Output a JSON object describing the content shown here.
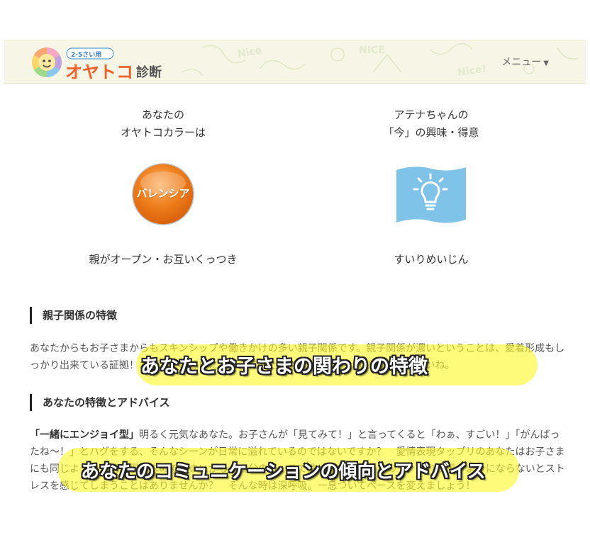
{
  "header": {
    "logo_age_tag": "2-5さい用",
    "logo_title": "オヤトコ",
    "logo_suffix": "診断",
    "menu_label": "メニュー"
  },
  "result_left": {
    "title_line1": "あなたの",
    "title_line2": "オヤトコカラーは",
    "badge_text": "バレンシア",
    "badge_color": "#ee7d1a",
    "caption": "親がオープン・お互いくっつき"
  },
  "result_right": {
    "title_line1": "アテナちゃんの",
    "title_line2": "「今」の興味・得意",
    "icon": "lightbulb-icon",
    "flag_color": "#7fc3e8",
    "caption": "すいりめいじん"
  },
  "section1": {
    "heading": "親子関係の特徴",
    "text": "あなたからもお子さまからもスキンシップや働きかけの多い親子関係です。親子関係が濃いということは、愛着形成もしっかり出来ている証拠！お子さまの想いにこたえて、たくさん愛情をかけてあげてくださいね。"
  },
  "section2": {
    "heading": "あなたの特徴とアドバイス",
    "type_label": "「一緒にエンジョイ型」",
    "text": "明るく元気なあなた。お子さんが「見てみて！」と言ってくると「わぁ、すごい！」「がんばったね～！」とハグをする、そんなシーンが日常に溢れているのではないですか？　愛情表現タップリのあなたはお子さまにも同じように愛情表現を求めてしまいがち。自分のペースで進めたいタイプなので、それが思うようにならないとストレスを感じてしまうことはありませんか？　そんな時は深呼吸。一息ついてペースを変えましょう！"
  },
  "callouts": {
    "callout1": "あなたとお子さまの関わりの特徴",
    "callout2": "あなたのコミュニケーションの傾向とアドバイス",
    "highlight_color": "#fff828"
  }
}
